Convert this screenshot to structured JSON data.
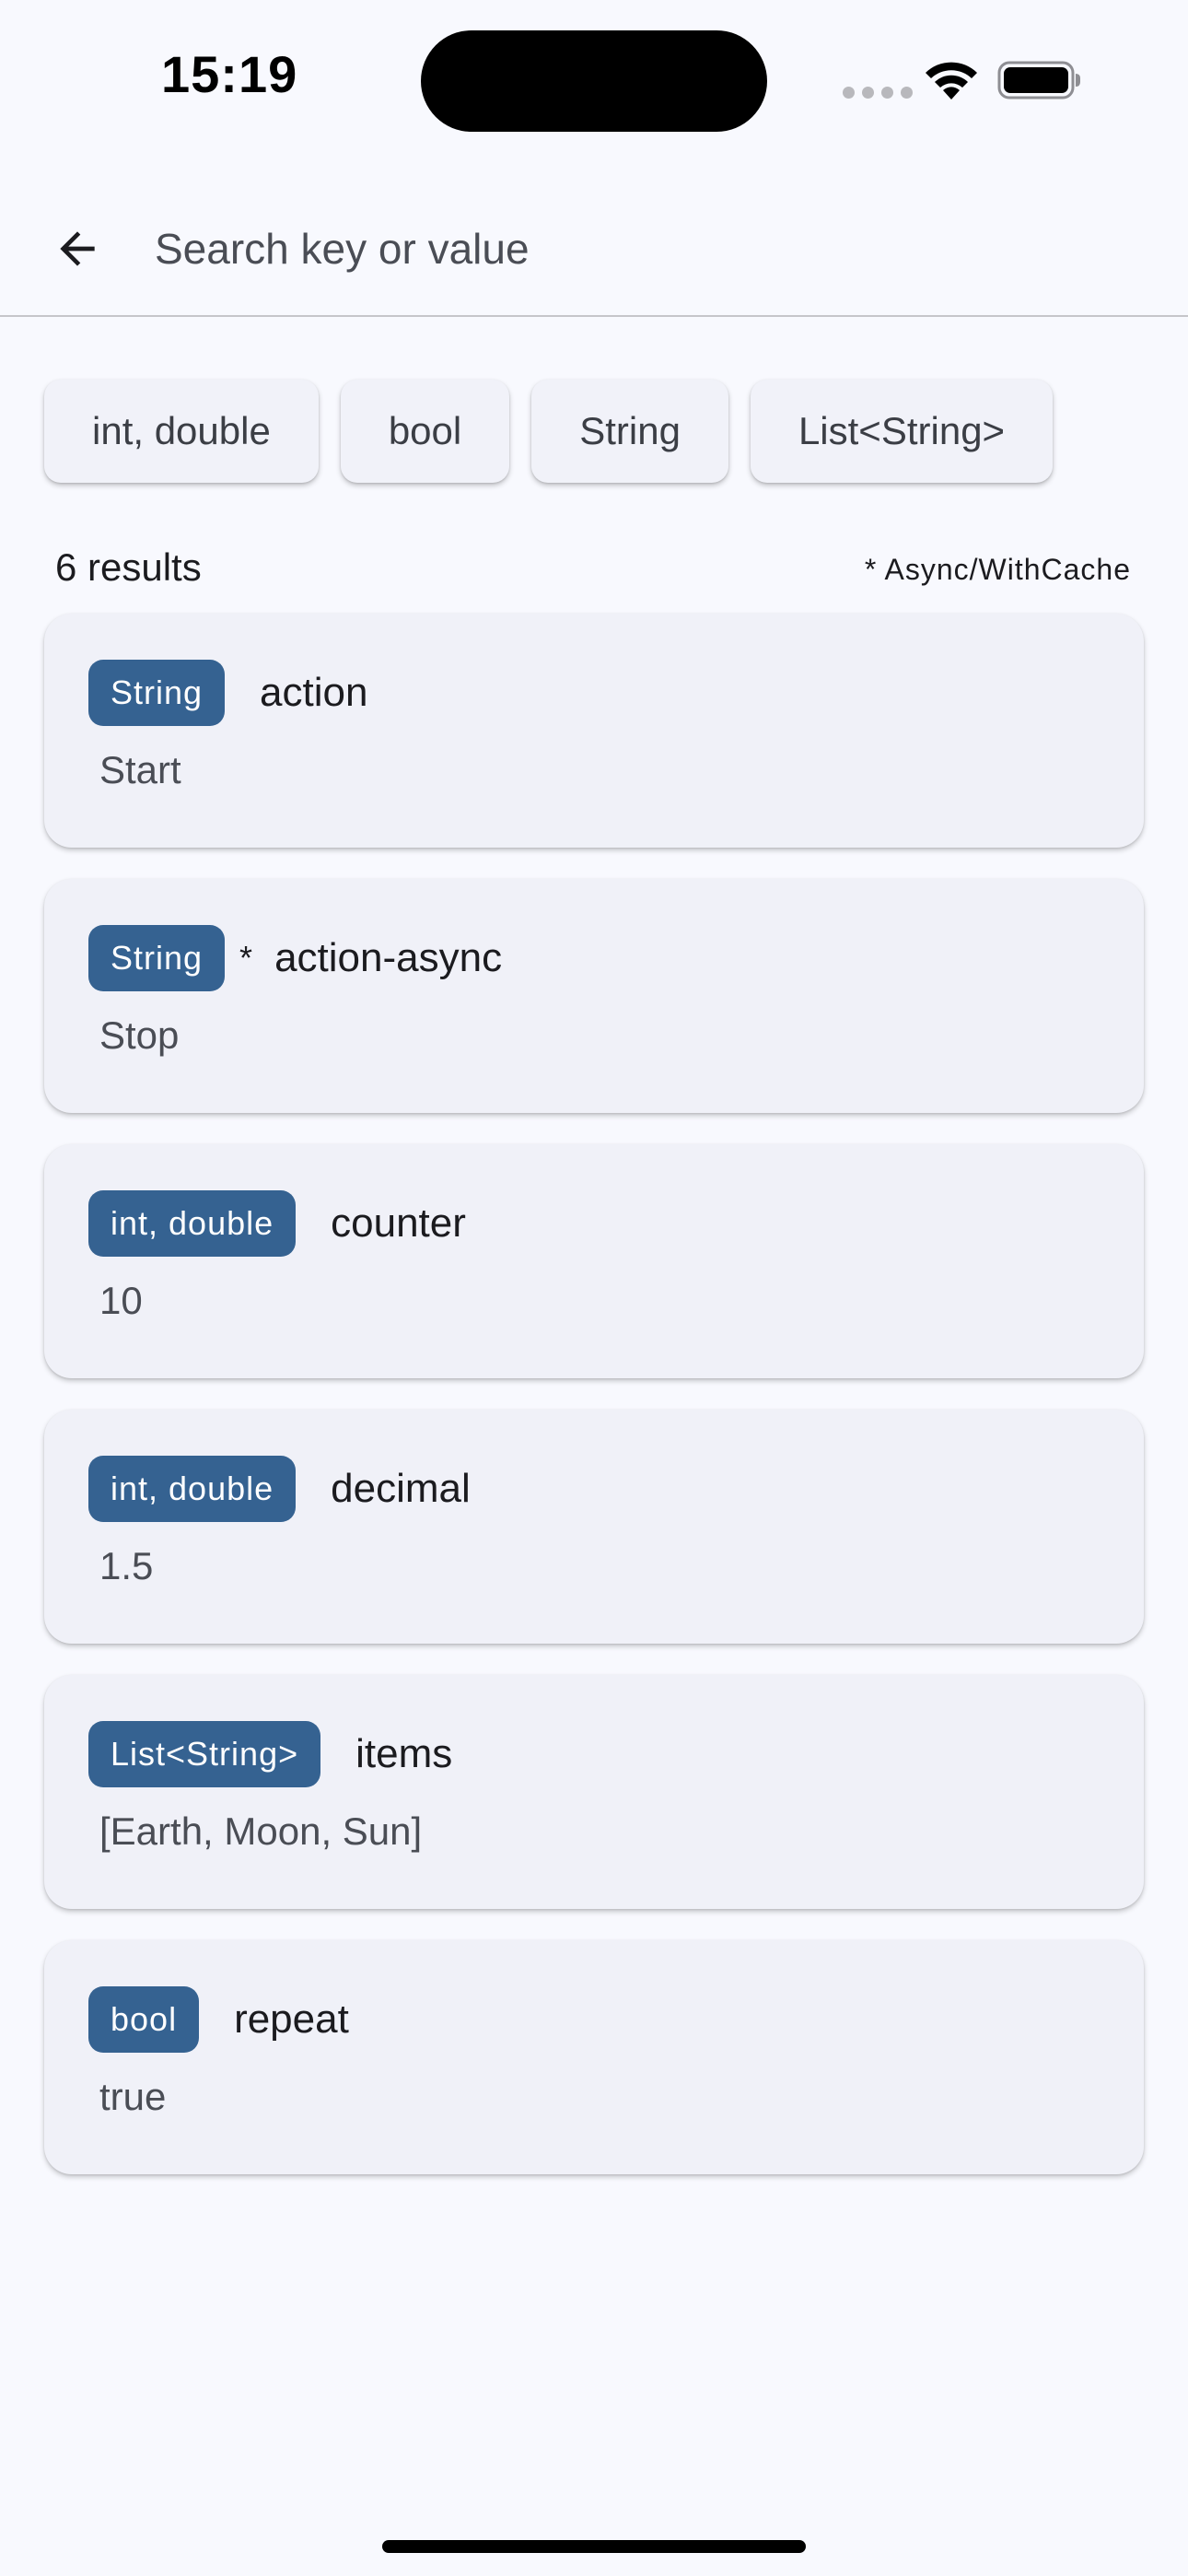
{
  "status_bar": {
    "time": "15:19"
  },
  "search": {
    "placeholder": "Search key or value"
  },
  "filters": [
    {
      "label": "int, double"
    },
    {
      "label": "bool"
    },
    {
      "label": "String"
    },
    {
      "label": "List<String>"
    }
  ],
  "results": {
    "count_label": "6 results",
    "legend": "* Async/WithCache",
    "items": [
      {
        "type": "String",
        "async_marker": "",
        "key": "action",
        "value": "Start"
      },
      {
        "type": "String",
        "async_marker": "*",
        "key": "action-async",
        "value": "Stop"
      },
      {
        "type": "int, double",
        "async_marker": "",
        "key": "counter",
        "value": "10"
      },
      {
        "type": "int, double",
        "async_marker": "",
        "key": "decimal",
        "value": "1.5"
      },
      {
        "type": "List<String>",
        "async_marker": "",
        "key": "items",
        "value": "[Earth, Moon, Sun]"
      },
      {
        "type": "bool",
        "async_marker": "",
        "key": "repeat",
        "value": "true"
      }
    ]
  },
  "colors": {
    "background": "#f8f9fe",
    "card": "#f0f1f8",
    "badge": "#356291",
    "badge_text": "#ffffff",
    "divider": "#c6c6ca"
  },
  "icons": {
    "back": "arrow-back-icon",
    "wifi": "wifi-icon",
    "battery": "battery-icon",
    "signal": "cellular-signal-icon"
  }
}
